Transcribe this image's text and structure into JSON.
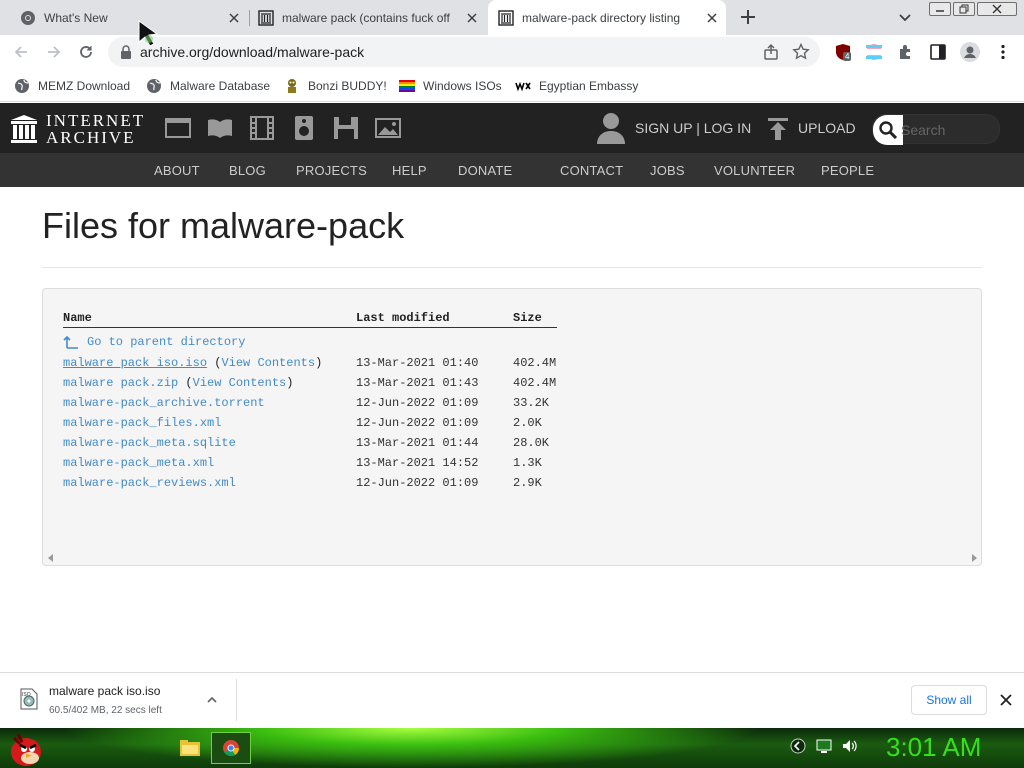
{
  "browser": {
    "tabs": [
      {
        "title": "What's New",
        "icon": "chrome-icon",
        "active": false
      },
      {
        "title": "malware pack (contains fuck off",
        "icon": "archive-icon",
        "active": false
      },
      {
        "title": "malware-pack directory listing",
        "icon": "archive-icon",
        "active": true
      }
    ],
    "url": "archive.org/download/malware-pack",
    "extension_badge": "4",
    "bookmarks": [
      {
        "label": "MEMZ Download",
        "icon": "globe-icon"
      },
      {
        "label": "Malware Database",
        "icon": "globe-icon"
      },
      {
        "label": "Bonzi BUDDY!",
        "icon": "bonzi-icon"
      },
      {
        "label": "Windows ISOs",
        "icon": "windows-flag-icon"
      },
      {
        "label": "Egyptian Embassy",
        "icon": "wix-icon"
      }
    ]
  },
  "ia": {
    "logo_line1": "INTERNET",
    "logo_line2": "ARCHIVE",
    "sign": "SIGN UP | LOG IN",
    "upload": "UPLOAD",
    "search_placeholder": "Search",
    "nav": [
      "ABOUT",
      "BLOG",
      "PROJECTS",
      "HELP",
      "DONATE",
      "CONTACT",
      "JOBS",
      "VOLUNTEER",
      "PEOPLE"
    ]
  },
  "page": {
    "title": "Files for malware-pack",
    "columns": {
      "name": "Name",
      "modified": "Last modified",
      "size": "Size"
    },
    "parent": "Go to parent directory",
    "view_contents": "View Contents",
    "files": [
      {
        "name": "malware pack iso.iso",
        "view": true,
        "modified": "13-Mar-2021 01:40",
        "size": "402.4M"
      },
      {
        "name": "malware pack.zip",
        "view": true,
        "modified": "13-Mar-2021 01:43",
        "size": "402.4M"
      },
      {
        "name": "malware-pack_archive.torrent",
        "view": false,
        "modified": "12-Jun-2022 01:09",
        "size": "33.2K"
      },
      {
        "name": "malware-pack_files.xml",
        "view": false,
        "modified": "12-Jun-2022 01:09",
        "size": "2.0K"
      },
      {
        "name": "malware-pack_meta.sqlite",
        "view": false,
        "modified": "13-Mar-2021 01:44",
        "size": "28.0K"
      },
      {
        "name": "malware-pack_meta.xml",
        "view": false,
        "modified": "13-Mar-2021 14:52",
        "size": "1.3K"
      },
      {
        "name": "malware-pack_reviews.xml",
        "view": false,
        "modified": "12-Jun-2022 01:09",
        "size": "2.9K"
      }
    ]
  },
  "download": {
    "filename": "malware pack iso.iso",
    "status": "60.5/402 MB, 22 secs left",
    "icon_label": "ISO",
    "show_all": "Show all"
  },
  "taskbar": {
    "clock": "3:01 AM"
  },
  "colors": {
    "link": "#428bca",
    "ia_dark": "#222222",
    "heart": "#e0262b",
    "clock": "#35e01a"
  }
}
